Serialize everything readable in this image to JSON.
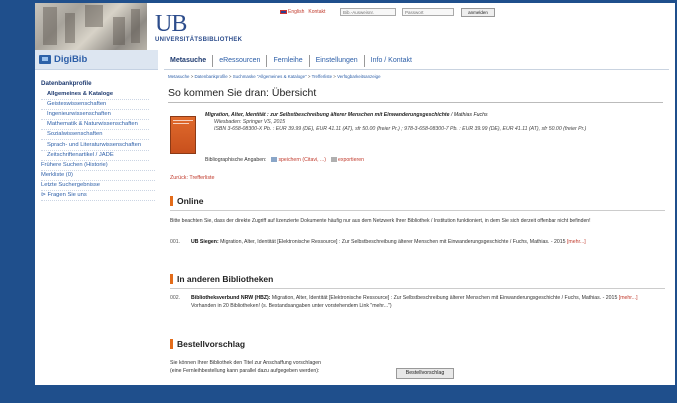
{
  "header": {
    "logo_main": "UB",
    "logo_sub": "UNIVERSITÄTSBIBLIOTHEK",
    "lang_link": "English",
    "contact_link": "Kontakt",
    "login_placeholder": "Bib.-Ausweisnr.",
    "password_placeholder": "Passwort",
    "login_button": "anmelden"
  },
  "sidebar": {
    "brand": "DigiBib",
    "heading": "Datenbankprofile",
    "items": [
      "Allgemeines & Kataloge",
      "Geisteswissenschaften",
      "Ingenieurwissenschaften",
      "Mathematik & Naturwissenschaften",
      "Sozialwissenschaften",
      "Sprach- und Literaturwissenschaften",
      "Zeitschriftenartikel / JADE"
    ],
    "main_links": [
      "Frühere Suchen (Historie)",
      "Merkliste (0)",
      "Letzte Suchergebnisse",
      "Fragen Sie uns"
    ]
  },
  "nav": {
    "tabs": [
      "Metasuche",
      "eRessourcen",
      "Fernleihe",
      "Einstellungen",
      "Info / Kontakt"
    ]
  },
  "breadcrumb": {
    "items": [
      "Metasuche",
      "Datenbankprofile",
      "Suchmaske \"Allgemeines & Kataloge\"",
      "Trefferliste",
      "Verfügbarkeitsanzeige"
    ],
    "sep": " > "
  },
  "page_title": "So kommen Sie dran: Übersicht",
  "record": {
    "title": "Migration, Alter, Identität : zur Selbstbeschreibung älterer Menschen mit Einwanderungsgeschichte",
    "author": " / Mathias Fuchs",
    "publisher": "Wiesbaden: Springer VS, 2015",
    "isbn": "ISBN 3-658-08300-X Pb. : EUR 39.99 (DE), EUR 41.11 (AT), sfr 50.00 (freier Pr.) ; 978-3-658-08300-7 Pb. : EUR 39.99 (DE), EUR 41.11 (AT), sfr 50.00 (freier Pr.)",
    "biblio_label": "Bibliographische Angaben:",
    "save_link": "speichern (Citavi, ...)",
    "export_link": "exportieren"
  },
  "back_link": "Zurück: Trefferliste",
  "online": {
    "heading": "Online",
    "note": "Bitte beachten Sie, dass der direkte Zugriff auf lizenzierte Dokumente häufig nur aus dem Netzwerk Ihrer Bibliothek / Institution funktioniert, in dem Sie sich derzeit offenbar nicht befinden!",
    "hit_num": "001.",
    "hit_source": "UB Siegen:",
    "hit_text": " Migration, Alter, Identität [Elektronische Ressource] : Zur Selbstbeschreibung älterer Menschen mit Einwanderungsgeschichte / Fuchs, Mathias. - 2015 ",
    "hit_more": "[mehr...]"
  },
  "other": {
    "heading": "In anderen Bibliotheken",
    "hit_num": "002.",
    "hit_source": "Bibliotheksverbund NRW (HBZ):",
    "hit_text": " Migration, Alter, Identität [Elektronische Ressource] : Zur Selbstbeschreibung älterer Menschen mit Einwanderungsgeschichte / Fuchs, Mathias. - 2015 ",
    "hit_more": "[mehr...]",
    "holdings": "Vorhanden in 20 Bibliotheken! (s. Bestandsangaben unter vorstehendem Link \"mehr...\")"
  },
  "suggestion": {
    "heading": "Bestellvorschlag",
    "line1": "Sie können Ihrer Bibliothek den Titel zur Anschaffung vorschlagen",
    "line2": "(eine Fernleihbestellung kann parallel dazu aufgegeben werden):",
    "button": "Bestellvorschlag"
  },
  "colors": {
    "frame": "#1f4f8c",
    "accent": "#e36c1a",
    "link": "#2d5fa8",
    "alert": "#c0392b"
  }
}
